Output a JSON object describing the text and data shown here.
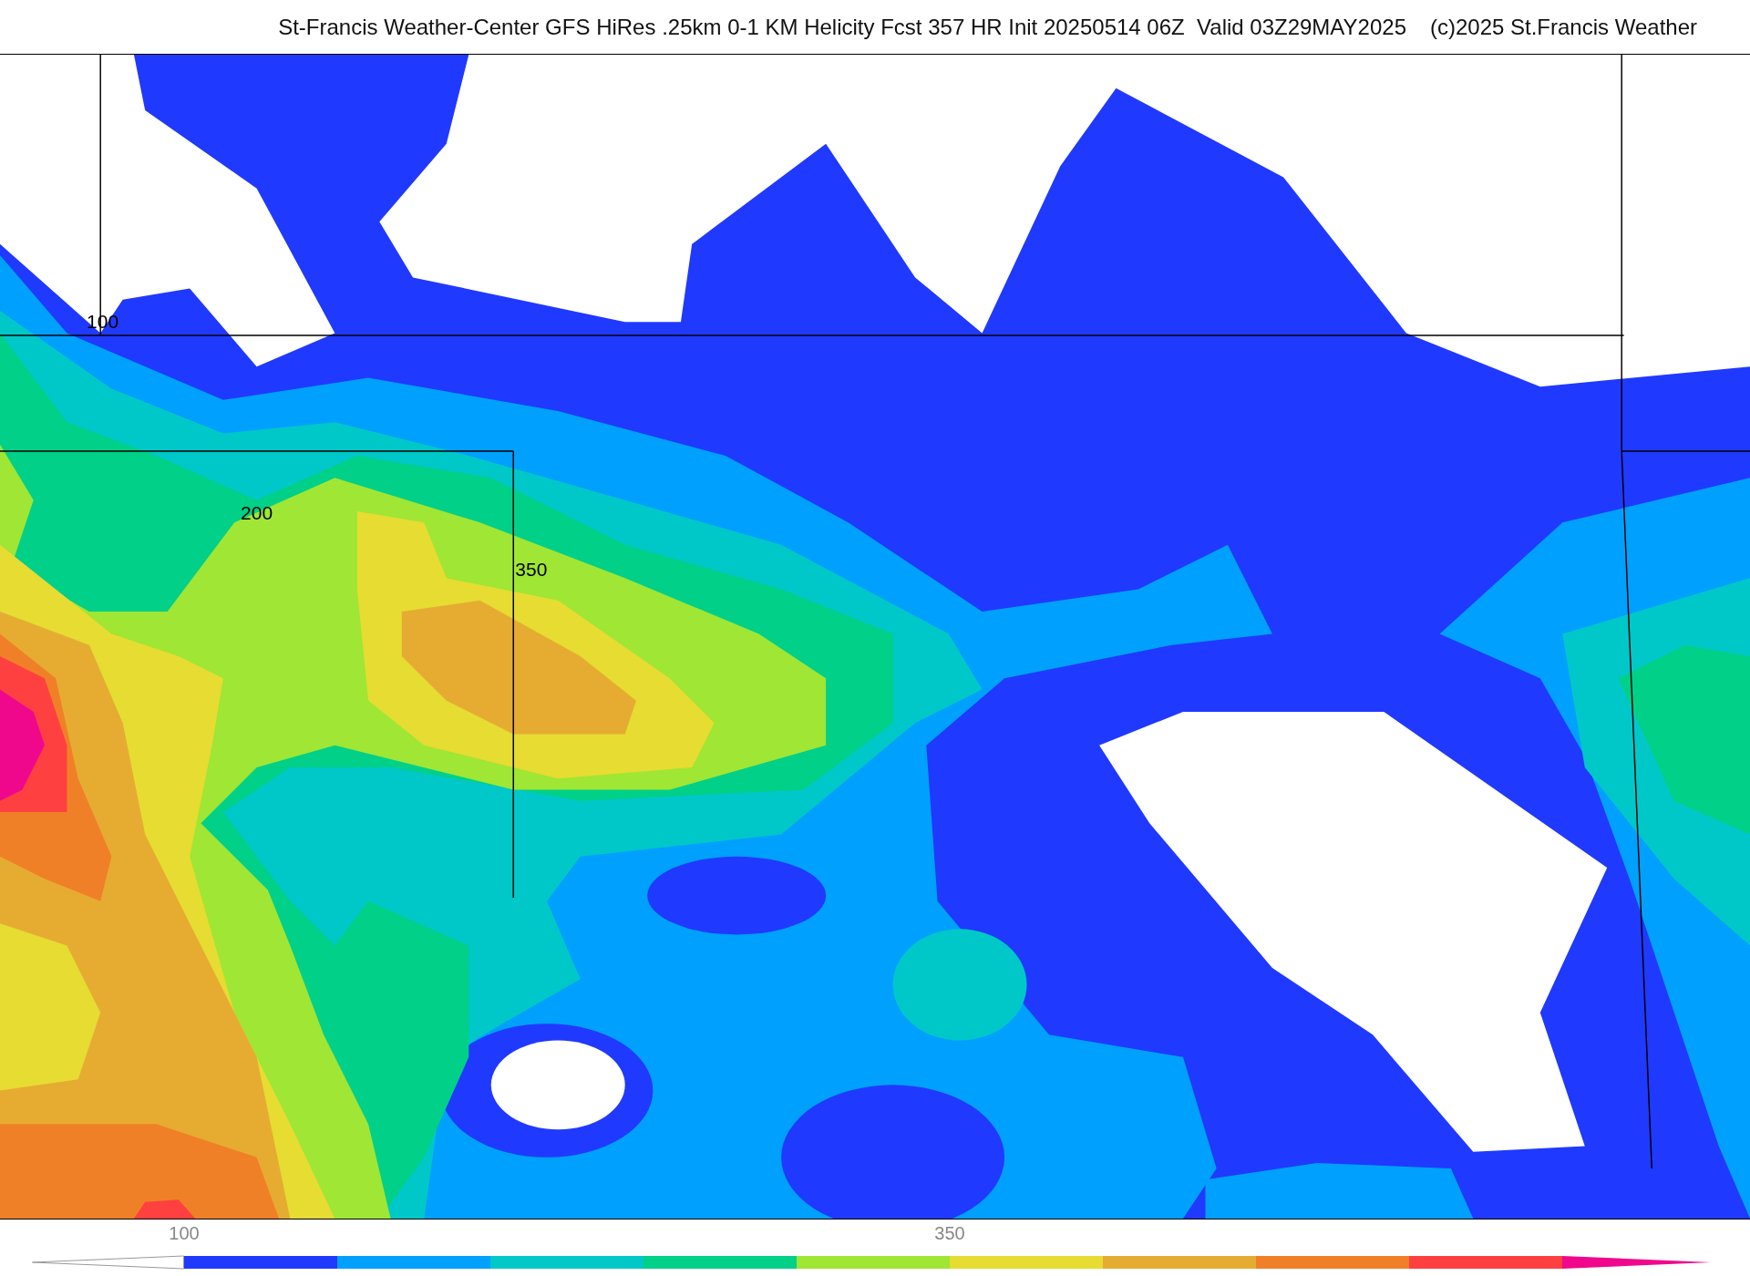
{
  "title": "St-Francis Weather-Center GFS HiRes .25km 0-1 KM Helicity Fcst 357 HR Init 20250514 06Z  Valid 03Z29MAY2025",
  "credit": "(c)2025 St.Francis Weather",
  "map": {
    "contour_labels": [
      "100",
      "200",
      "350"
    ]
  },
  "colorbar": {
    "segments": [
      {
        "kind": "low-end",
        "color": "#ffffff"
      },
      {
        "kind": "band",
        "color": "#2039ff"
      },
      {
        "kind": "band",
        "color": "#00a0ff"
      },
      {
        "kind": "band",
        "color": "#00c8c8"
      },
      {
        "kind": "band",
        "color": "#00d088"
      },
      {
        "kind": "band",
        "color": "#a0e634"
      },
      {
        "kind": "band",
        "color": "#e6dc32"
      },
      {
        "kind": "band",
        "color": "#e6ac32"
      },
      {
        "kind": "band",
        "color": "#f08028"
      },
      {
        "kind": "band",
        "color": "#ff4040"
      },
      {
        "kind": "high-end",
        "color": "#f0088c"
      }
    ],
    "ticks": [
      "100",
      "350"
    ]
  }
}
